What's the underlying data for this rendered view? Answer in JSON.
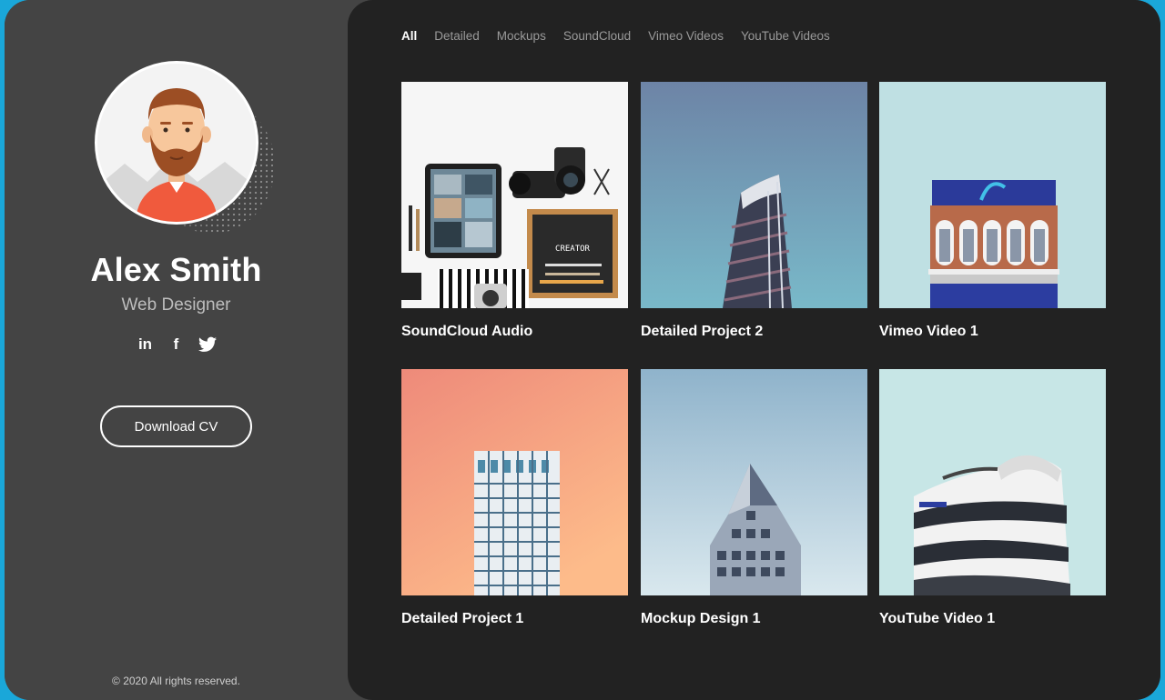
{
  "profile": {
    "name": "Alex Smith",
    "role": "Web Designer",
    "social": [
      {
        "icon": "linkedin-icon",
        "glyph": "in"
      },
      {
        "icon": "facebook-icon",
        "glyph": "f"
      },
      {
        "icon": "twitter-icon",
        "glyph": ""
      }
    ],
    "download_label": "Download CV",
    "copyright": "© 2020 All rights reserved."
  },
  "filters": [
    {
      "label": "All",
      "active": true
    },
    {
      "label": "Detailed"
    },
    {
      "label": "Mockups"
    },
    {
      "label": "SoundCloud"
    },
    {
      "label": "Vimeo Videos"
    },
    {
      "label": "YouTube Videos"
    }
  ],
  "projects": [
    {
      "title": "SoundCloud Audio"
    },
    {
      "title": "Detailed Project 2"
    },
    {
      "title": "Vimeo Video 1"
    },
    {
      "title": "Detailed Project 1"
    },
    {
      "title": "Mockup Design 1"
    },
    {
      "title": "YouTube Video 1"
    }
  ],
  "colors": {
    "frame": "#1aa7d9",
    "sidebar": "#444444",
    "main": "#222222"
  }
}
